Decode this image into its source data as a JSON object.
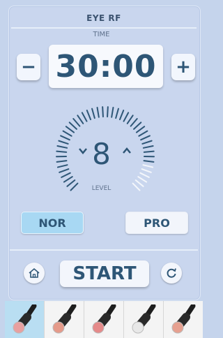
{
  "header": {
    "title": "EYE RF"
  },
  "timer": {
    "label": "TIME",
    "value": "30:00",
    "minus_label": "−",
    "plus_label": "+"
  },
  "level": {
    "value": "8",
    "label": "LEVEL",
    "max": 26,
    "decrease_icon": "chevron-down-icon",
    "increase_icon": "chevron-up-icon"
  },
  "modes": {
    "nor_label": "NOR",
    "pro_label": "PRO",
    "selected": "NOR"
  },
  "controls": {
    "start_label": "START",
    "home_icon": "home-icon",
    "reset_icon": "refresh-icon"
  },
  "probes": {
    "items": [
      "probe-1",
      "probe-2",
      "probe-3",
      "probe-4",
      "probe-5"
    ],
    "selected_index": 0
  },
  "colors": {
    "accent": "#2e5676",
    "background": "#c5d4ec",
    "selected_mode": "#a8d8f3",
    "selected_probe": "#b9def2"
  }
}
